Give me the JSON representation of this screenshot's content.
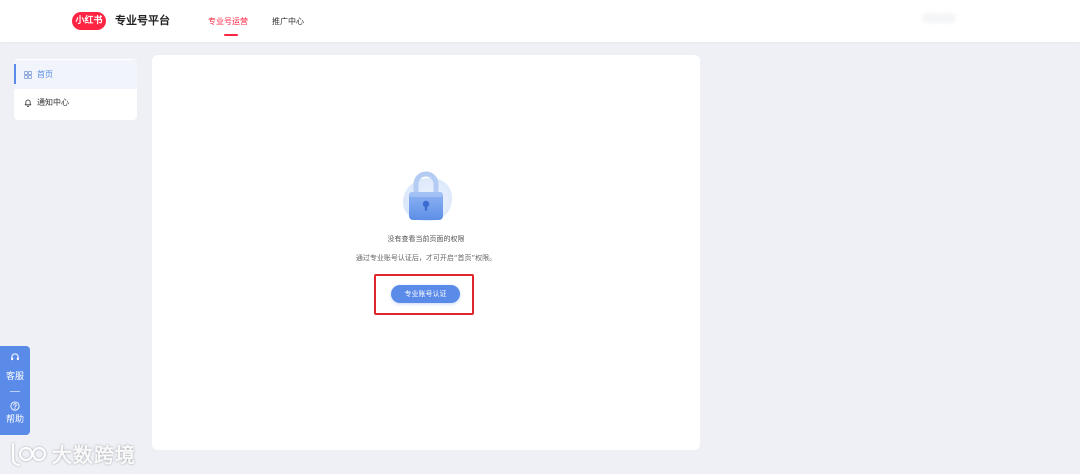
{
  "colors": {
    "brand_red": "#ff2442",
    "accent_blue": "#5b8be8",
    "highlight_red": "#e0262b",
    "page_bg": "#eef0f6"
  },
  "header": {
    "logo_text": "小红书",
    "title": "专业号平台",
    "tabs": [
      {
        "label": "专业号运营",
        "active": true
      },
      {
        "label": "推广中心",
        "active": false
      }
    ]
  },
  "sidebar": {
    "items": [
      {
        "label": "首页",
        "icon": "grid-icon",
        "active": true
      },
      {
        "label": "通知中心",
        "icon": "bell-icon",
        "active": false
      }
    ]
  },
  "main": {
    "illustration": "lock-icon",
    "message": "没有查看当前页面的权限",
    "hint": "通过专业账号认证后，才可开启“首页”权限。",
    "cta_label": "专业账号认证",
    "cta_highlighted": true
  },
  "float_widget": {
    "items": [
      {
        "label": "客服",
        "icon": "headset-icon"
      },
      {
        "label": "帮助",
        "icon": "help-icon"
      }
    ]
  },
  "watermark": {
    "text": "大数跨境"
  }
}
